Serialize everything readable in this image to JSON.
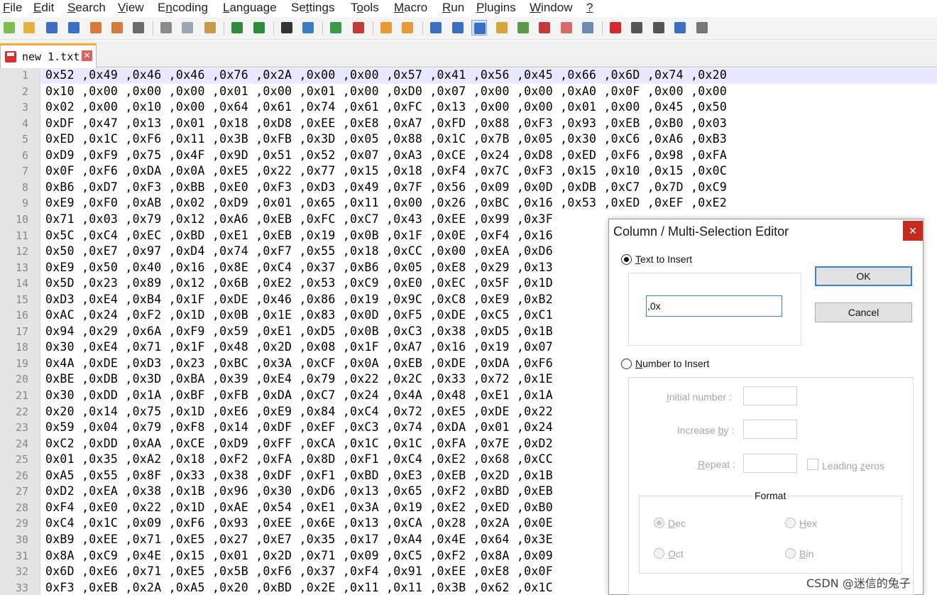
{
  "menu": [
    {
      "pre": "",
      "u": "F",
      "post": "ile"
    },
    {
      "pre": "",
      "u": "E",
      "post": "dit"
    },
    {
      "pre": "",
      "u": "S",
      "post": "earch"
    },
    {
      "pre": "",
      "u": "V",
      "post": "iew"
    },
    {
      "pre": "E",
      "u": "n",
      "post": "coding"
    },
    {
      "pre": "",
      "u": "L",
      "post": "anguage"
    },
    {
      "pre": "Se",
      "u": "t",
      "post": "tings"
    },
    {
      "pre": "T",
      "u": "o",
      "post": "ols"
    },
    {
      "pre": "",
      "u": "M",
      "post": "acro"
    },
    {
      "pre": "",
      "u": "R",
      "post": "un"
    },
    {
      "pre": "",
      "u": "P",
      "post": "lugins"
    },
    {
      "pre": "",
      "u": "W",
      "post": "indow"
    },
    {
      "pre": "",
      "u": "?",
      "post": ""
    }
  ],
  "toolbar": [
    {
      "icon": "new-file-icon",
      "color": "#7cbf4a"
    },
    {
      "icon": "open-file-icon",
      "color": "#e8b23a"
    },
    {
      "icon": "save-icon",
      "color": "#3a6fc4"
    },
    {
      "icon": "save-all-icon",
      "color": "#3a6fc4"
    },
    {
      "icon": "close-icon",
      "color": "#d87a3a"
    },
    {
      "icon": "close-all-icon",
      "color": "#d87a3a"
    },
    {
      "icon": "print-icon",
      "color": "#6b6b6b"
    },
    {
      "icon": "cut-icon",
      "color": "#8a8a8a"
    },
    {
      "icon": "copy-icon",
      "color": "#9aa5b5"
    },
    {
      "icon": "paste-icon",
      "color": "#c99a45"
    },
    {
      "icon": "undo-icon",
      "color": "#2f8a3a"
    },
    {
      "icon": "redo-icon",
      "color": "#2f8a3a"
    },
    {
      "icon": "find-icon",
      "color": "#333333"
    },
    {
      "icon": "replace-icon",
      "color": "#3a7fc4"
    },
    {
      "icon": "zoom-in-icon",
      "color": "#3a9a4a"
    },
    {
      "icon": "zoom-out-icon",
      "color": "#c43a3a"
    },
    {
      "icon": "sync-vertical-icon",
      "color": "#e89a3a"
    },
    {
      "icon": "sync-horizontal-icon",
      "color": "#e89a3a"
    },
    {
      "icon": "word-wrap-icon",
      "color": "#3a6fc4"
    },
    {
      "icon": "show-all-chars-icon",
      "color": "#3a6fc4"
    },
    {
      "icon": "indent-guide-icon",
      "color": "#3a6fc4"
    },
    {
      "icon": "language-icon",
      "color": "#d8a53a"
    },
    {
      "icon": "doc-map-icon",
      "color": "#5a9a4a"
    },
    {
      "icon": "function-list-icon",
      "color": "#c43a3a"
    },
    {
      "icon": "folder-workspace-icon",
      "color": "#d86a6a"
    },
    {
      "icon": "monitoring-icon",
      "color": "#6b8ab5"
    },
    {
      "icon": "record-macro-icon",
      "color": "#d42a2a"
    },
    {
      "icon": "stop-recording-icon",
      "color": "#555555"
    },
    {
      "icon": "playback-icon",
      "color": "#555555"
    },
    {
      "icon": "run-macro-multiple-icon",
      "color": "#3a6fc4"
    },
    {
      "icon": "save-macro-icon",
      "color": "#777777"
    }
  ],
  "tab": {
    "name": "new 1.txt",
    "close": "✕"
  },
  "editor": {
    "lines": [
      {
        "n": "1",
        "text": "0x52 ,0x49 ,0x46 ,0x46 ,0x76 ,0x2A ,0x00 ,0x00 ,0x57 ,0x41 ,0x56 ,0x45 ,0x66 ,0x6D ,0x74 ,0x20"
      },
      {
        "n": "2",
        "text": "0x10 ,0x00 ,0x00 ,0x00 ,0x01 ,0x00 ,0x01 ,0x00 ,0xD0 ,0x07 ,0x00 ,0x00 ,0xA0 ,0x0F ,0x00 ,0x00"
      },
      {
        "n": "3",
        "text": "0x02 ,0x00 ,0x10 ,0x00 ,0x64 ,0x61 ,0x74 ,0x61 ,0xFC ,0x13 ,0x00 ,0x00 ,0x01 ,0x00 ,0x45 ,0x50"
      },
      {
        "n": "4",
        "text": "0xDF ,0x47 ,0x13 ,0x01 ,0x18 ,0xD8 ,0xEE ,0xE8 ,0xA7 ,0xFD ,0x88 ,0xF3 ,0x93 ,0xEB ,0xB0 ,0x03"
      },
      {
        "n": "5",
        "text": "0xED ,0x1C ,0xF6 ,0x11 ,0x3B ,0xFB ,0x3D ,0x05 ,0x88 ,0x1C ,0x7B ,0x05 ,0x30 ,0xC6 ,0xA6 ,0xB3"
      },
      {
        "n": "6",
        "text": "0xD9 ,0xF9 ,0x75 ,0x4F ,0x9D ,0x51 ,0x52 ,0x07 ,0xA3 ,0xCE ,0x24 ,0xD8 ,0xED ,0xF6 ,0x98 ,0xFA"
      },
      {
        "n": "7",
        "text": "0x0F ,0xF6 ,0xDA ,0x0A ,0xE5 ,0x22 ,0x77 ,0x15 ,0x18 ,0xF4 ,0x7C ,0xF3 ,0x15 ,0x10 ,0x15 ,0x0C"
      },
      {
        "n": "8",
        "text": "0xB6 ,0xD7 ,0xF3 ,0xBB ,0xE0 ,0xF3 ,0xD3 ,0x49 ,0x7F ,0x56 ,0x09 ,0x0D ,0xDB ,0xC7 ,0x7D ,0xC9"
      },
      {
        "n": "9",
        "text": "0xE9 ,0xF0 ,0xAB ,0x02 ,0xD9 ,0x01 ,0x65 ,0x11 ,0x00 ,0x26 ,0xBC ,0x16 ,0x53 ,0xED ,0xEF ,0xE2"
      },
      {
        "n": "10",
        "text": "0x71 ,0x03 ,0x79 ,0x12 ,0xA6 ,0xEB ,0xFC ,0xC7 ,0x43 ,0xEE ,0x99 ,0x3F"
      },
      {
        "n": "11",
        "text": "0x5C ,0xC4 ,0xEC ,0xBD ,0xE1 ,0xEB ,0x19 ,0x0B ,0x1F ,0x0E ,0xF4 ,0x16"
      },
      {
        "n": "12",
        "text": "0x50 ,0xE7 ,0x97 ,0xD4 ,0x74 ,0xF7 ,0x55 ,0x18 ,0xCC ,0x00 ,0xEA ,0xD6"
      },
      {
        "n": "13",
        "text": "0xE9 ,0x50 ,0x40 ,0x16 ,0x8E ,0xC4 ,0x37 ,0xB6 ,0x05 ,0xE8 ,0x29 ,0x13"
      },
      {
        "n": "14",
        "text": "0x5D ,0x23 ,0x89 ,0x12 ,0x6B ,0xE2 ,0x53 ,0xC9 ,0xE0 ,0xEC ,0x5F ,0x1D"
      },
      {
        "n": "15",
        "text": "0xD3 ,0xE4 ,0xB4 ,0x1F ,0xDE ,0x46 ,0x86 ,0x19 ,0x9C ,0xC8 ,0xE9 ,0xB2"
      },
      {
        "n": "16",
        "text": "0xAC ,0x24 ,0xF2 ,0x1D ,0x0B ,0x1E ,0x83 ,0x0D ,0xF5 ,0xDE ,0xC5 ,0xC1"
      },
      {
        "n": "17",
        "text": "0x94 ,0x29 ,0x6A ,0xF9 ,0x59 ,0xE1 ,0xD5 ,0x0B ,0xC3 ,0x38 ,0xD5 ,0x1B"
      },
      {
        "n": "18",
        "text": "0x30 ,0xE4 ,0x71 ,0x1F ,0x48 ,0x2D ,0x08 ,0x1F ,0xA7 ,0x16 ,0x19 ,0x07"
      },
      {
        "n": "19",
        "text": "0x4A ,0xDE ,0xD3 ,0x23 ,0xBC ,0x3A ,0xCF ,0x0A ,0xEB ,0xDE ,0xDA ,0xF6"
      },
      {
        "n": "20",
        "text": "0xBE ,0xDB ,0x3D ,0xBA ,0x39 ,0xE4 ,0x79 ,0x22 ,0x2C ,0x33 ,0x72 ,0x1E"
      },
      {
        "n": "21",
        "text": "0x30 ,0xDD ,0x1A ,0xBF ,0xFB ,0xDA ,0xC7 ,0x24 ,0x4A ,0x48 ,0xE1 ,0x1A"
      },
      {
        "n": "22",
        "text": "0x20 ,0x14 ,0x75 ,0x1D ,0xE6 ,0xE9 ,0x84 ,0xC4 ,0x72 ,0xE5 ,0xDE ,0x22"
      },
      {
        "n": "23",
        "text": "0x59 ,0x04 ,0x79 ,0xF8 ,0x14 ,0xDF ,0xEF ,0xC3 ,0x74 ,0xDA ,0x01 ,0x24"
      },
      {
        "n": "24",
        "text": "0xC2 ,0xDD ,0xAA ,0xCE ,0xD9 ,0xFF ,0xCA ,0x1C ,0x1C ,0xFA ,0x7E ,0xD2"
      },
      {
        "n": "25",
        "text": "0x01 ,0x35 ,0xA2 ,0x18 ,0xF2 ,0xFA ,0x8D ,0xF1 ,0xC4 ,0xE2 ,0x68 ,0xCC"
      },
      {
        "n": "26",
        "text": "0xA5 ,0x55 ,0x8F ,0x33 ,0x38 ,0xDF ,0xF1 ,0xBD ,0xE3 ,0xEB ,0x2D ,0x1B"
      },
      {
        "n": "27",
        "text": "0xD2 ,0xEA ,0x38 ,0x1B ,0x96 ,0x30 ,0xD6 ,0x13 ,0x65 ,0xF2 ,0xBD ,0xEB"
      },
      {
        "n": "28",
        "text": "0xF4 ,0xE0 ,0x22 ,0x1D ,0xAE ,0x54 ,0xE1 ,0x3A ,0x19 ,0xE2 ,0xED ,0xB0"
      },
      {
        "n": "29",
        "text": "0xC4 ,0x1C ,0x09 ,0xF6 ,0x93 ,0xEE ,0x6E ,0x13 ,0xCA ,0x28 ,0x2A ,0x0E"
      },
      {
        "n": "30",
        "text": "0xB9 ,0xEE ,0x71 ,0xE5 ,0x27 ,0xE7 ,0x35 ,0x17 ,0xA4 ,0x4E ,0x64 ,0x3E"
      },
      {
        "n": "31",
        "text": "0x8A ,0xC9 ,0x4E ,0x15 ,0x01 ,0x2D ,0x71 ,0x09 ,0xC5 ,0xF2 ,0x8A ,0x09"
      },
      {
        "n": "32",
        "text": "0x6D ,0xE6 ,0x71 ,0xE5 ,0x5B ,0xF6 ,0x37 ,0xF4 ,0x91 ,0xEE ,0xE8 ,0x0F"
      },
      {
        "n": "33",
        "text": "0xF3 ,0xEB ,0x2A ,0xA5 ,0x20 ,0xBD ,0x2E ,0x11 ,0x11 ,0x3B ,0x62 ,0x1C"
      }
    ]
  },
  "dialog": {
    "title": "Column / Multi-Selection Editor",
    "close": "✕",
    "text_to_insert": {
      "u": "T",
      "rest": "ext to Insert",
      "value": ",0x",
      "selected": true
    },
    "ok": "OK",
    "cancel": "Cancel",
    "number_to_insert": {
      "u": "N",
      "rest": "umber to Insert",
      "selected": false
    },
    "initial_number": {
      "u": "I",
      "rest": "nitial number :",
      "value": ""
    },
    "increase_by": {
      "pre": "Increase ",
      "u": "b",
      "rest": "y :",
      "value": ""
    },
    "repeat": {
      "u": "R",
      "rest": "epeat :",
      "value": ""
    },
    "leading_zeros": {
      "pre": "Leading ",
      "u": "z",
      "rest": "eros",
      "checked": false
    },
    "format": {
      "title": "Format",
      "dec": {
        "u": "D",
        "rest": "ec",
        "selected": true
      },
      "hex": {
        "u": "H",
        "rest": "ex",
        "selected": false
      },
      "oct": {
        "u": "O",
        "rest": "ct",
        "selected": false
      },
      "bin": {
        "u": "B",
        "rest": "in",
        "selected": false
      }
    }
  },
  "watermark": "CSDN @迷信的兔子"
}
